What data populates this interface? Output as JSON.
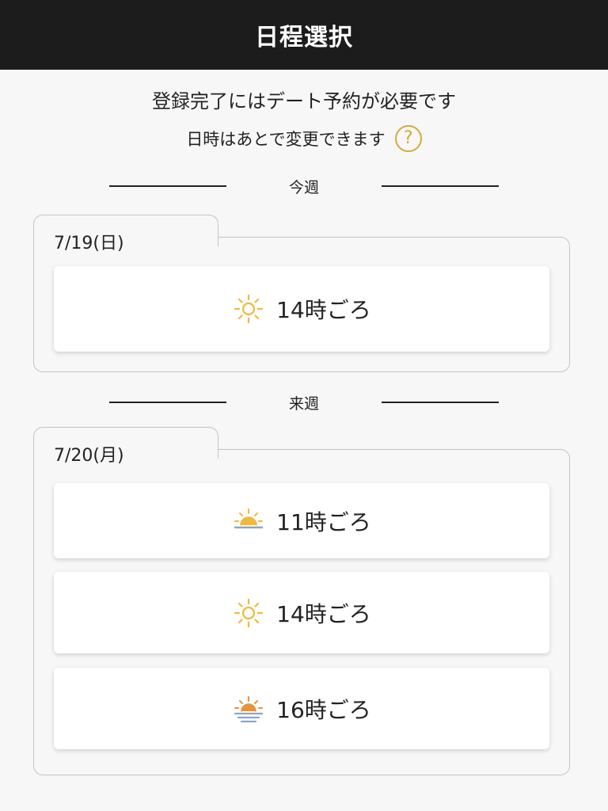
{
  "header": {
    "title": "日程選択"
  },
  "intro": {
    "line1": "登録完了にはデート予約が必要です",
    "line2": "日時はあとで変更できます",
    "help_icon": "question-circle-icon",
    "help_glyph": "?"
  },
  "colors": {
    "header_bg": "#1c1c1c",
    "accent": "#d6a93a",
    "sun_yellow": "#f0b93a",
    "sunset_orange": "#e8923a",
    "water_blue": "#8aa6c4"
  },
  "weeks": [
    {
      "label": "今週",
      "days": [
        {
          "date": "7/19(日)",
          "slots": [
            {
              "label": "14時ごろ",
              "icon": "sun-icon"
            }
          ]
        }
      ]
    },
    {
      "label": "来週",
      "days": [
        {
          "date": "7/20(月)",
          "slots": [
            {
              "label": "11時ごろ",
              "icon": "sunrise-icon"
            },
            {
              "label": "14時ごろ",
              "icon": "sun-icon"
            },
            {
              "label": "16時ごろ",
              "icon": "sunset-icon"
            }
          ]
        }
      ]
    }
  ]
}
